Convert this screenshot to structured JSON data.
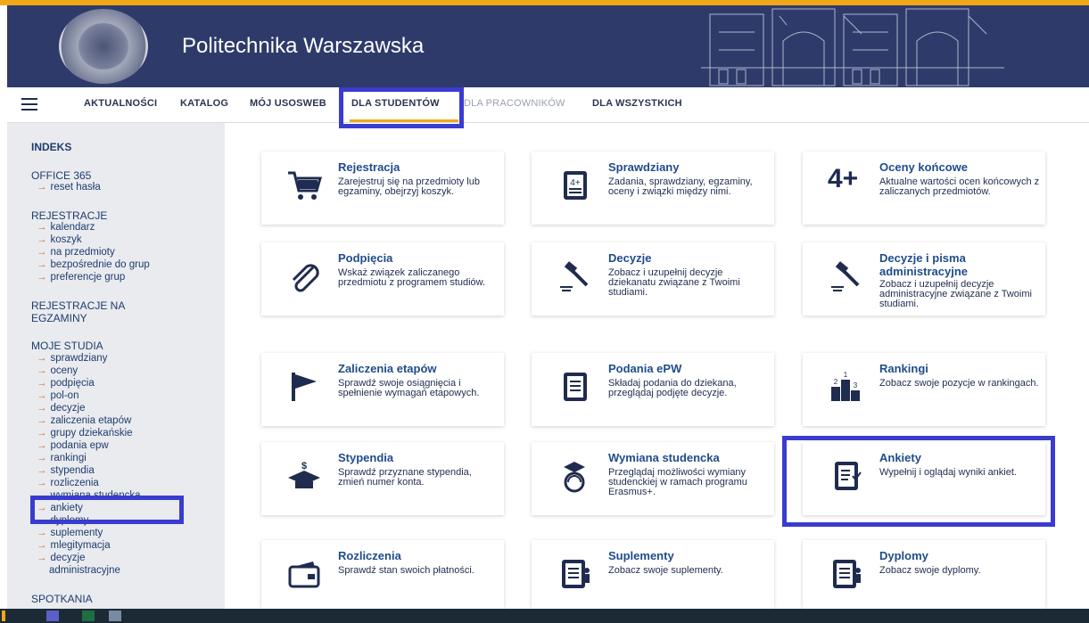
{
  "header": {
    "title": "Politechnika Warszawska"
  },
  "nav": [
    "AKTUALNOŚCI",
    "KATALOG",
    "MÓJ USOSWEB",
    "DLA STUDENTÓW",
    "DLA PRACOWNIKÓW",
    "DLA WSZYSTKICH"
  ],
  "sidebar": {
    "indeks": "INDEKS",
    "office": "OFFICE 365",
    "office_links": [
      "reset hasła"
    ],
    "rejestracje": "REJESTRACJE",
    "rejestracje_links": [
      "kalendarz",
      "koszyk",
      "na przedmioty",
      "bezpośrednie do grup",
      "preferencje grup"
    ],
    "rejestracje_egz_1": "REJESTRACJE NA",
    "rejestracje_egz_2": "EGZAMINY",
    "moje_studia": "MOJE STUDIA",
    "moje_links": [
      "sprawdziany",
      "oceny",
      "podpięcia",
      "pol-on",
      "decyzje",
      "zaliczenia etapów",
      "grupy dziekańskie",
      "podania epw",
      "rankingi",
      "stypendia",
      "rozliczenia",
      "wymiana studencka",
      "ankiety",
      "dyplomy",
      "suplementy",
      "mlegitymacja",
      "decyzje",
      "administracyjne"
    ],
    "spotkania": "SPOTKANIA"
  },
  "cards": [
    {
      "title": "Rejestracja",
      "desc": "Zarejestruj się na przedmioty lub egzaminy, obejrzyj koszyk.",
      "icon": "cart-icon"
    },
    {
      "title": "Sprawdziany",
      "desc": "Zadania, sprawdziany, egzaminy, oceny i związki między nimi.",
      "icon": "test-icon"
    },
    {
      "title": "Oceny końcowe",
      "desc": "Aktualne wartości ocen końcowych z zaliczanych przedmiotów.",
      "icon": "grade-icon",
      "icon_text": "4+"
    },
    {
      "title": "Podpięcia",
      "desc": "Wskaż związek zaliczanego przedmiotu z programem studiów.",
      "icon": "paperclip-icon"
    },
    {
      "title": "Decyzje",
      "desc": "Zobacz i uzupełnij decyzje dziekanatu związane z Twoimi studiami.",
      "icon": "gavel-icon"
    },
    {
      "title": "Decyzje i pisma administracyjne",
      "desc": "Zobacz i uzupełnij decyzje administracyjne związane z Twoimi studiami.",
      "icon": "gavel-icon"
    },
    {
      "title": "Zaliczenia etapów",
      "desc": "Sprawdź swoje osiągnięcia i spełnienie wymagań etapowych.",
      "icon": "flag-icon"
    },
    {
      "title": "Podania ePW",
      "desc": "Składaj podania do dziekana, przeglądaj podjęte decyzje.",
      "icon": "document-icon"
    },
    {
      "title": "Rankingi",
      "desc": "Zobacz swoje pozycje w rankingach.",
      "icon": "podium-icon"
    },
    {
      "title": "Stypendia",
      "desc": "Sprawdź przyznane stypendia, zmień numer konta.",
      "icon": "scholarship-icon"
    },
    {
      "title": "Wymiana studencka",
      "desc": "Przeglądaj możliwości wymiany studenckiej w ramach programu Erasmus+.",
      "icon": "exchange-icon"
    },
    {
      "title": "Ankiety",
      "desc": "Wypełnij i oglądaj wyniki ankiet.",
      "icon": "survey-icon"
    },
    {
      "title": "Rozliczenia",
      "desc": "Sprawdź stan swoich płatności.",
      "icon": "wallet-icon"
    },
    {
      "title": "Suplementy",
      "desc": "Zobacz swoje suplementy.",
      "icon": "supplement-icon"
    },
    {
      "title": "Dyplomy",
      "desc": "Zobacz swoje dyplomy.",
      "icon": "diploma-icon"
    }
  ],
  "colors": {
    "accent": "#f0a818",
    "header": "#2e3b6a",
    "highlight": "#3a3cd0",
    "link": "#1f4c8c"
  }
}
